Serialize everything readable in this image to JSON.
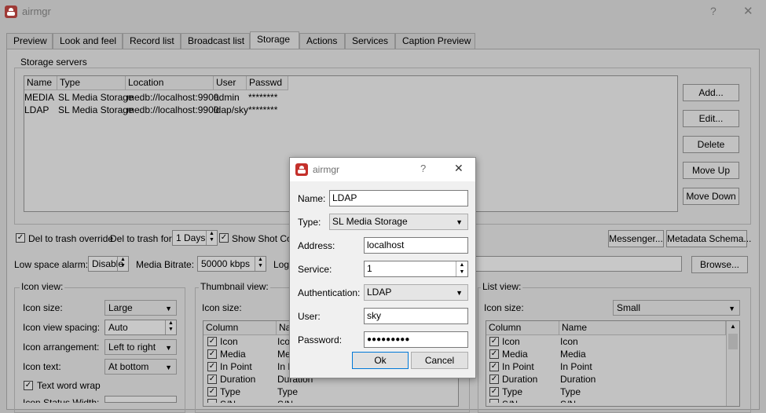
{
  "main_window": {
    "title": "airmgr",
    "help_glyph": "?",
    "close_glyph": "✕",
    "tabs": [
      {
        "label": "Preview"
      },
      {
        "label": "Look and feel"
      },
      {
        "label": "Record list"
      },
      {
        "label": "Broadcast list"
      },
      {
        "label": "Storage"
      },
      {
        "label": "Actions"
      },
      {
        "label": "Services"
      },
      {
        "label": "Caption Preview"
      }
    ],
    "storage_servers": {
      "title": "Storage servers",
      "columns": [
        "Name",
        "Type",
        "Location",
        "User",
        "Passwd"
      ],
      "rows": [
        [
          "MEDIA",
          "SL Media Storage",
          "medb://localhost:9900",
          "admin",
          "********"
        ],
        [
          "LDAP",
          "SL Media Storage",
          "medb://localhost:9900",
          "ldap/sky",
          "********"
        ]
      ],
      "buttons": {
        "add": "Add...",
        "edit": "Edit...",
        "delete": "Delete",
        "move_up": "Move Up",
        "move_down": "Move Down"
      }
    },
    "options": {
      "del_to_trash_override": "Del to trash override",
      "del_to_trash_for": "Del to trash for:",
      "del_to_trash_value": "1 Days",
      "show_shot_cop": "Show Shot Cop",
      "messenger_button": "Messenger...",
      "metadata_schema_button": "Metadata Schema...",
      "low_space_alarm": "Low space alarm:",
      "low_space_value": "Disable",
      "media_bitrate": "Media Bitrate:",
      "media_bitrate_value": "50000 kbps",
      "log_label": "Log",
      "browse_button": "Browse..."
    },
    "icon_view": {
      "title": "Icon view:",
      "icon_size_label": "Icon size:",
      "icon_size_value": "Large",
      "spacing_label": "Icon view spacing:",
      "spacing_value": "Auto",
      "arrangement_label": "Icon arrangement:",
      "arrangement_value": "Left to right",
      "text_label": "Icon text:",
      "text_value": "At bottom",
      "word_wrap": "Text word wrap",
      "status_width_label": "Icon Status Width:"
    },
    "thumbnail_view": {
      "title": "Thumbnail view:",
      "icon_size_label": "Icon size:",
      "columns": [
        "Column",
        "Na"
      ],
      "rows": [
        [
          "Icon",
          "Ico"
        ],
        [
          "Media",
          "Me"
        ],
        [
          "In Point",
          "In P"
        ],
        [
          "Duration",
          "Duration"
        ],
        [
          "Type",
          "Type"
        ],
        [
          "S/N",
          "S/N"
        ]
      ]
    },
    "list_view": {
      "title": "List view:",
      "icon_size_label": "Icon size:",
      "icon_size_value": "Small",
      "columns": [
        "Column",
        "Name"
      ],
      "rows": [
        [
          "Icon",
          "Icon"
        ],
        [
          "Media",
          "Media"
        ],
        [
          "In Point",
          "In Point"
        ],
        [
          "Duration",
          "Duration"
        ],
        [
          "Type",
          "Type"
        ],
        [
          "S/N",
          "S/N"
        ]
      ]
    }
  },
  "dialog": {
    "title": "airmgr",
    "help_glyph": "?",
    "close_glyph": "✕",
    "name_label": "Name:",
    "name_value": "LDAP",
    "type_label": "Type:",
    "type_value": "SL Media Storage",
    "address_label": "Address:",
    "address_value": "localhost",
    "service_label": "Service:",
    "service_value": "1",
    "auth_label": "Authentication:",
    "auth_value": "LDAP",
    "user_label": "User:",
    "user_value": "sky",
    "password_label": "Password:",
    "password_value": "●●●●●●●●●",
    "ok": "Ok",
    "cancel": "Cancel"
  },
  "colors": {
    "dimmed_background": "#bcbcbc",
    "dialog_background": "#f0f0f0",
    "focus_border": "#0078d7",
    "app_icon": "#c4302b"
  },
  "icons": [
    "app-icon",
    "help-icon",
    "close-icon",
    "checkbox-checked-icon",
    "chevron-down-icon",
    "spin-arrows-icon"
  ]
}
